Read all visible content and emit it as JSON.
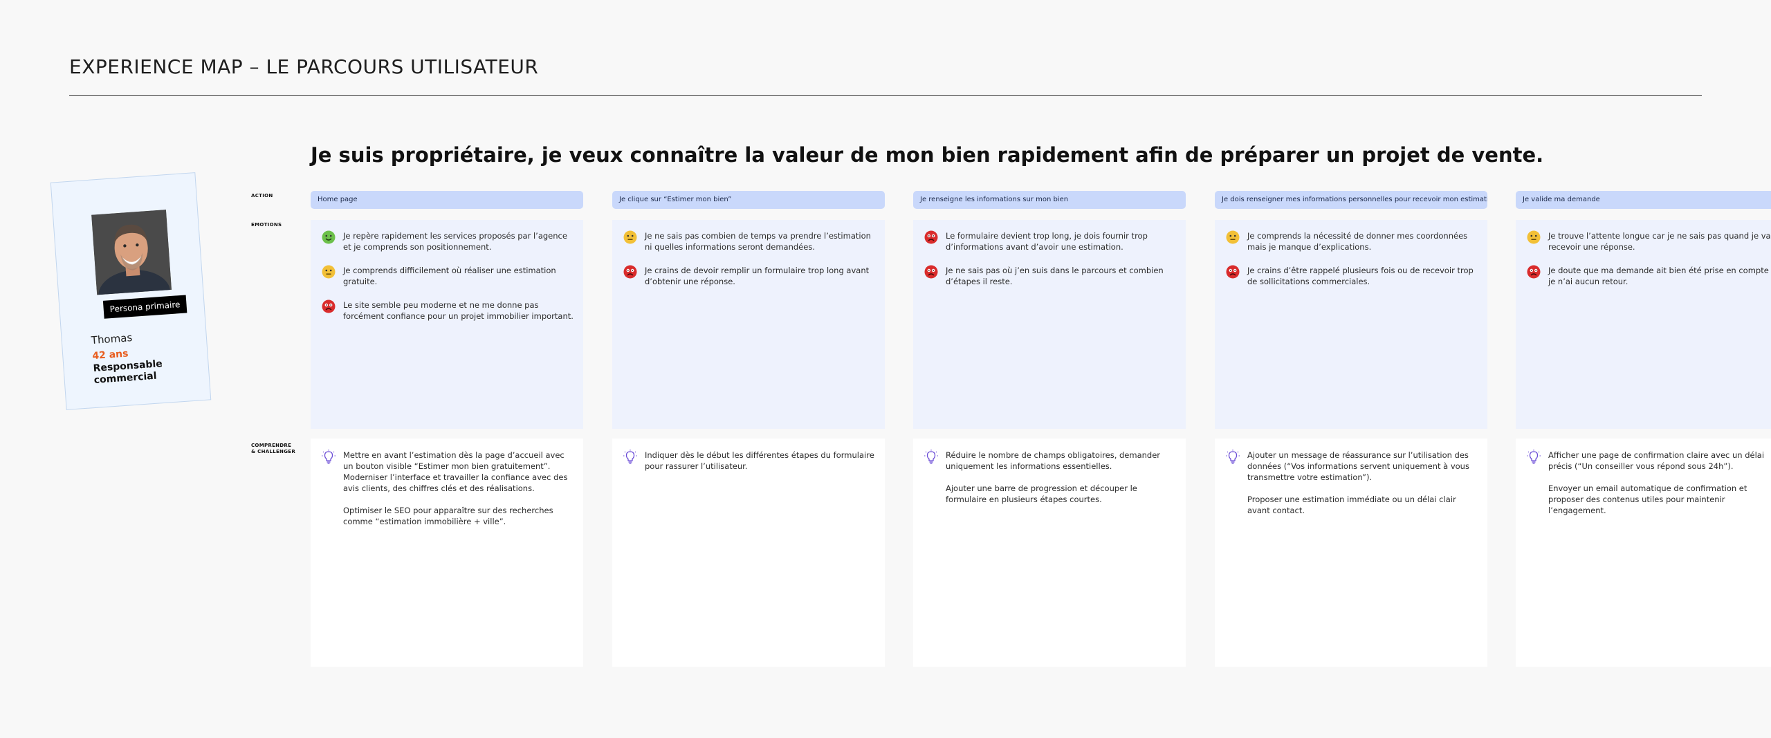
{
  "header": {
    "title": "EXPERIENCE MAP – LE PARCOURS UTILISATEUR",
    "headline": "Je suis propriétaire, je veux connaître la valeur de mon bien rapidement afin de préparer un projet de vente."
  },
  "persona": {
    "badge": "Persona primaire",
    "name": "Thomas",
    "age": "42 ans",
    "job": "Responsable commercial"
  },
  "row_labels": {
    "action": "ACTION",
    "emotions": "EMOTIONS",
    "challenge_line1": "COMPRENDRE",
    "challenge_line2": "& CHALLENGER"
  },
  "colors": {
    "positive": "#6cc04a",
    "neutral": "#f2c037",
    "negative": "#d92c2c",
    "action_bg": "#c9d8fb",
    "emotion_bg": "#eef2fd",
    "accent_age": "#e85d1f",
    "bulb": "#6a4bd6"
  },
  "steps": [
    {
      "action": "Home page",
      "emotions": [
        {
          "mood": "positive",
          "icon": "happy-face-icon",
          "text": "Je repère rapidement les services proposés par l’agence et je comprends son positionnement."
        },
        {
          "mood": "neutral",
          "icon": "neutral-face-icon",
          "text": "Je comprends difficilement où réaliser une estimation gratuite."
        },
        {
          "mood": "negative",
          "icon": "sad-face-icon",
          "text": "Le site semble peu moderne et ne me donne pas forcément confiance pour un projet immobilier important."
        }
      ],
      "challenge": [
        "Mettre en avant l’estimation dès la page d’accueil avec un bouton visible “Estimer mon bien gratuitement”. Moderniser l’interface et travailler la confiance avec des avis clients, des chiffres clés et des réalisations.",
        "Optimiser le SEO pour apparaître sur des recherches comme “estimation immobilière + ville”."
      ]
    },
    {
      "action": "Je clique sur “Estimer mon bien”",
      "emotions": [
        {
          "mood": "neutral",
          "icon": "neutral-face-icon",
          "text": "Je ne sais pas combien de temps va prendre l’estimation ni quelles informations seront demandées."
        },
        {
          "mood": "negative",
          "icon": "sad-face-icon",
          "text": "Je crains de devoir remplir un formulaire trop long avant d’obtenir une réponse."
        }
      ],
      "challenge": [
        "Indiquer dès le début les différentes étapes du formulaire pour rassurer l’utilisateur."
      ]
    },
    {
      "action": "Je renseigne les informations sur mon bien",
      "emotions": [
        {
          "mood": "negative",
          "icon": "sad-face-icon",
          "text": "Le formulaire devient trop long, je dois fournir trop d’informations avant d’avoir une estimation."
        },
        {
          "mood": "negative",
          "icon": "sad-face-icon",
          "text": "Je ne sais pas où j’en suis dans le parcours et combien d’étapes il reste."
        }
      ],
      "challenge": [
        "Réduire le nombre de champs obligatoires, demander uniquement les informations essentielles.",
        "Ajouter une barre de progression et découper le formulaire en plusieurs étapes courtes."
      ]
    },
    {
      "action": "Je dois renseigner mes informations personnelles pour recevoir mon estimation.",
      "emotions": [
        {
          "mood": "neutral",
          "icon": "neutral-face-icon",
          "text": "Je comprends la nécessité de donner mes coordonnées mais je manque d’explications."
        },
        {
          "mood": "negative",
          "icon": "sad-face-icon",
          "text": "Je crains d’être rappelé plusieurs fois ou de recevoir trop de sollicitations commerciales."
        }
      ],
      "challenge": [
        "Ajouter un message de réassurance sur l’utilisation des données (“Vos informations servent uniquement à vous transmettre votre estimation”).",
        "Proposer une estimation immédiate ou un délai clair avant contact."
      ]
    },
    {
      "action": "Je valide ma demande",
      "emotions": [
        {
          "mood": "neutral",
          "icon": "neutral-face-icon",
          "text": "Je trouve l’attente longue car je ne sais pas quand je vais recevoir une réponse."
        },
        {
          "mood": "negative",
          "icon": "sad-face-icon",
          "text": "Je doute que ma demande ait bien été prise en compte si je n’ai aucun retour."
        }
      ],
      "challenge": [
        "Afficher une page de confirmation claire avec un délai précis (“Un conseiller vous répond sous 24h”).",
        "Envoyer un email automatique de confirmation et proposer des contenus utiles pour maintenir l’engagement."
      ]
    }
  ]
}
